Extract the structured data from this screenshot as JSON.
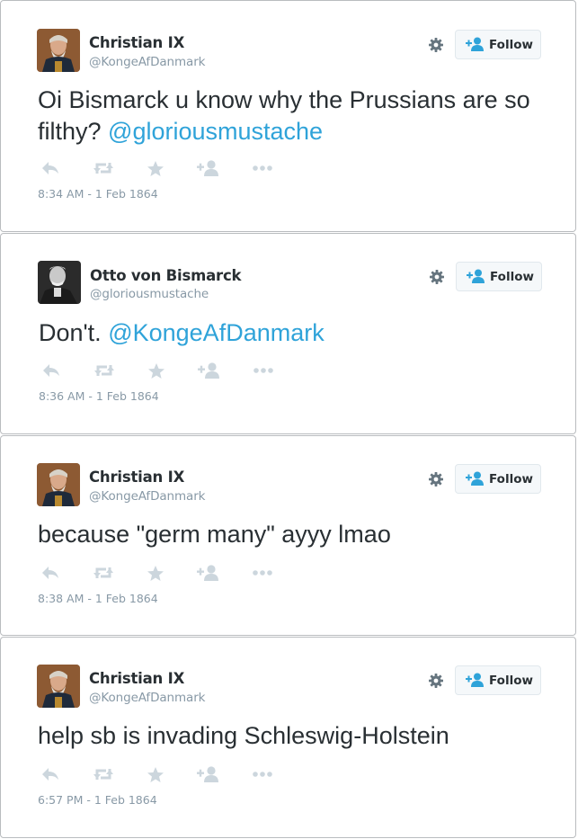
{
  "tweets": [
    {
      "name": "Christian IX",
      "handle": "@KongeAfDanmark",
      "text_before": "Oi Bismarck u know why the Prussians are so filthy? ",
      "mention": "@gloriousmustache",
      "text_after": "",
      "timestamp": "8:34 AM - 1 Feb 1864",
      "follow_label": "Follow"
    },
    {
      "name": "Otto von Bismarck",
      "handle": "@gloriousmustache",
      "text_before": "Don't. ",
      "mention": "@KongeAfDanmark",
      "text_after": "",
      "timestamp": "8:36 AM - 1 Feb 1864",
      "follow_label": "Follow"
    },
    {
      "name": "Christian IX",
      "handle": "@KongeAfDanmark",
      "text_before": "because \"germ many\" ayyy lmao",
      "mention": "",
      "text_after": "",
      "timestamp": "8:38 AM - 1 Feb 1864",
      "follow_label": "Follow"
    },
    {
      "name": "Christian IX",
      "handle": "@KongeAfDanmark",
      "text_before": "help sb is invading Schleswig-Holstein",
      "mention": "",
      "text_after": "",
      "timestamp": "6:57 PM - 1 Feb 1864",
      "follow_label": "Follow"
    }
  ],
  "icons": {
    "settings": "gear-icon",
    "follow": "add-user-icon",
    "reply": "reply-icon",
    "retweet": "retweet-icon",
    "favorite": "star-icon",
    "add_follow": "add-user-icon",
    "more": "more-dots-icon"
  },
  "colors": {
    "mention": "#2fa3d9",
    "follow_icon": "#2fa3d9",
    "action_icon": "#ccd6dd",
    "muted_text": "#8899a6"
  }
}
